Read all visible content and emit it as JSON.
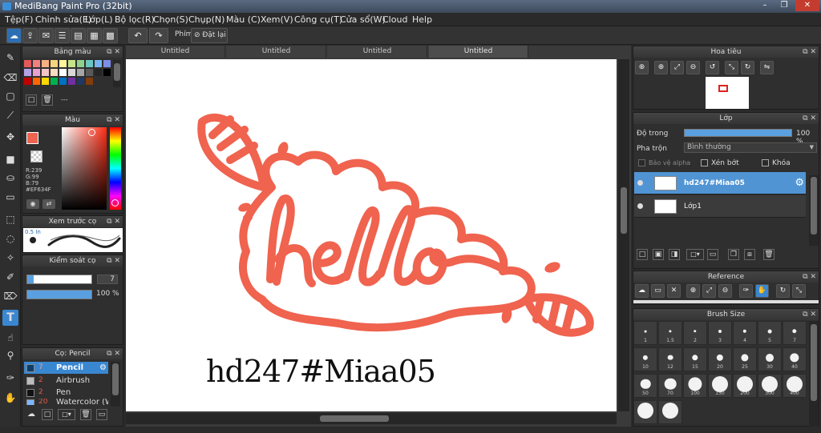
{
  "window": {
    "title": "MediBang Paint Pro (32bit)",
    "minimize": "–",
    "maximize": "❐",
    "close": "✕"
  },
  "menu": [
    "Tệp(F)",
    "Chỉnh sửa(E)",
    "Lớp(L)",
    "Bộ lọc(R)",
    "Chọn(S)",
    "Chụp(N)",
    "Màu (C)",
    "Xem(V)",
    "Công cụ(T)",
    "Cửa sổ(W)",
    "Cloud",
    "Help"
  ],
  "toolbar": {
    "shortcut_label": "Phím",
    "reset_label": "Đặt lại"
  },
  "palette_panel": {
    "title": "Bảng màu",
    "separator": "---"
  },
  "color_panel": {
    "title": "Màu",
    "r": "R:239",
    "g": "G:99",
    "b": "B:79",
    "hex": "#EF634F",
    "accent": "#EF634F"
  },
  "brush_preview": {
    "title": "Xem trước cọ",
    "size": "0.5 In"
  },
  "brush_control": {
    "title": "Kiểm soát cọ",
    "size_value": "7",
    "opacity_value": "100 %"
  },
  "brush_list": {
    "title": "Cọ: Pencil",
    "items": [
      {
        "num": "7",
        "name": "Pencil",
        "color": "#0f3d66",
        "selected": true
      },
      {
        "num": "2",
        "name": "Airbrush",
        "color": "#bdbdbd",
        "selected": false
      },
      {
        "num": "2",
        "name": "Pen",
        "color": "#111111",
        "selected": false
      },
      {
        "num": "20",
        "name": "Watercolor (Wet)",
        "color": "#7fb6ff",
        "selected": false
      }
    ]
  },
  "tabs": [
    "Untitled",
    "Untitled",
    "Untitled",
    "Untitled"
  ],
  "canvas": {
    "lettering": "hello",
    "caption": "hd247#Miaa05",
    "stroke_color": "#EF634F"
  },
  "navigator": {
    "title": "Hoa tiêu"
  },
  "layer_panel": {
    "title": "Lớp",
    "opacity_label": "Độ trong",
    "opacity_value": "100 %",
    "opacity_fraction": 1.0,
    "blend_label": "Pha trộn",
    "blend_value": "Bình thường",
    "protect_alpha": "Bảo vệ alpha",
    "clip": "Xén bớt",
    "lock": "Khóa",
    "layers": [
      {
        "name": "hd247#Miaa05",
        "selected": true
      },
      {
        "name": "Lớp1",
        "selected": false
      }
    ]
  },
  "reference_panel": {
    "title": "Reference"
  },
  "brush_size_panel": {
    "title": "Brush Size",
    "sizes": [
      "1",
      "1.5",
      "2",
      "3",
      "4",
      "5",
      "7",
      "10",
      "12",
      "15",
      "20",
      "25",
      "30",
      "40",
      "50",
      "70",
      "100",
      "150",
      "200",
      "300",
      "400",
      "",
      ""
    ]
  }
}
